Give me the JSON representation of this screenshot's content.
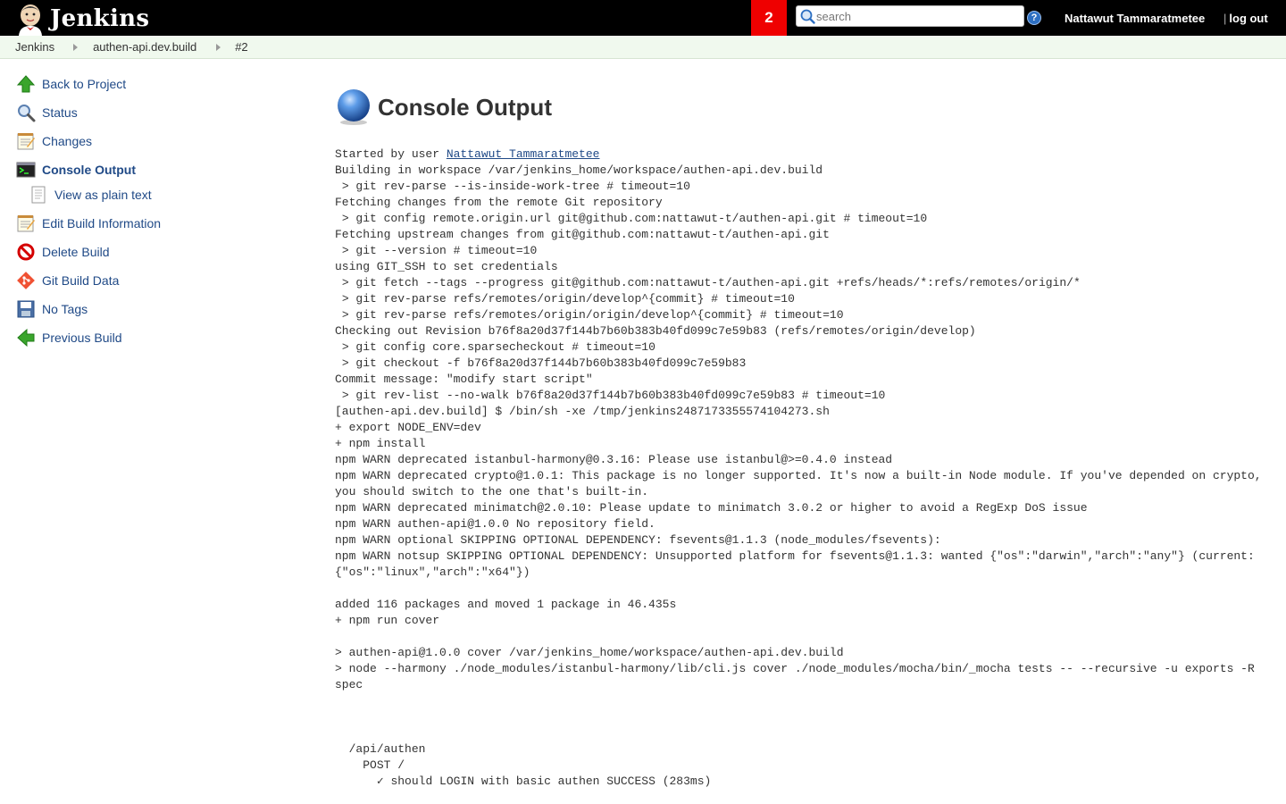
{
  "header": {
    "title": "Jenkins",
    "notification_count": "2",
    "search_placeholder": "search",
    "help_label": "?",
    "user_name": "Nattawut Tammaratmetee",
    "logout_label": "log out",
    "logout_separator": "|",
    "colors": {
      "bar": "#000000",
      "notification": "#ef0000"
    }
  },
  "breadcrumbs": [
    "Jenkins",
    "authen-api.dev.build",
    "#2"
  ],
  "sidebar": {
    "items": [
      {
        "label": "Back to Project",
        "icon": "up-arrow-icon"
      },
      {
        "label": "Status",
        "icon": "magnifier-icon"
      },
      {
        "label": "Changes",
        "icon": "notepad-icon"
      },
      {
        "label": "Console Output",
        "icon": "terminal-icon",
        "active": true
      },
      {
        "label": "View as plain text",
        "icon": "document-icon",
        "sub": true
      },
      {
        "label": "Edit Build Information",
        "icon": "notepad-icon"
      },
      {
        "label": "Delete Build",
        "icon": "no-entry-icon"
      },
      {
        "label": "Git Build Data",
        "icon": "git-icon"
      },
      {
        "label": "No Tags",
        "icon": "save-icon"
      },
      {
        "label": "Previous Build",
        "icon": "left-arrow-icon"
      }
    ]
  },
  "main": {
    "title": "Console Output",
    "started_by_prefix": "Started by user ",
    "started_by_user": "Nattawut Tammaratmetee",
    "console_text": "Building in workspace /var/jenkins_home/workspace/authen-api.dev.build\n > git rev-parse --is-inside-work-tree # timeout=10\nFetching changes from the remote Git repository\n > git config remote.origin.url git@github.com:nattawut-t/authen-api.git # timeout=10\nFetching upstream changes from git@github.com:nattawut-t/authen-api.git\n > git --version # timeout=10\nusing GIT_SSH to set credentials\n > git fetch --tags --progress git@github.com:nattawut-t/authen-api.git +refs/heads/*:refs/remotes/origin/*\n > git rev-parse refs/remotes/origin/develop^{commit} # timeout=10\n > git rev-parse refs/remotes/origin/origin/develop^{commit} # timeout=10\nChecking out Revision b76f8a20d37f144b7b60b383b40fd099c7e59b83 (refs/remotes/origin/develop)\n > git config core.sparsecheckout # timeout=10\n > git checkout -f b76f8a20d37f144b7b60b383b40fd099c7e59b83\nCommit message: \"modify start script\"\n > git rev-list --no-walk b76f8a20d37f144b7b60b383b40fd099c7e59b83 # timeout=10\n[authen-api.dev.build] $ /bin/sh -xe /tmp/jenkins2487173355574104273.sh\n+ export NODE_ENV=dev\n+ npm install\nnpm WARN deprecated istanbul-harmony@0.3.16: Please use istanbul@>=0.4.0 instead\nnpm WARN deprecated crypto@1.0.1: This package is no longer supported. It's now a built-in Node module. If you've depended on crypto, you should switch to the one that's built-in.\nnpm WARN deprecated minimatch@2.0.10: Please update to minimatch 3.0.2 or higher to avoid a RegExp DoS issue\nnpm WARN authen-api@1.0.0 No repository field.\nnpm WARN optional SKIPPING OPTIONAL DEPENDENCY: fsevents@1.1.3 (node_modules/fsevents):\nnpm WARN notsup SKIPPING OPTIONAL DEPENDENCY: Unsupported platform for fsevents@1.1.3: wanted {\"os\":\"darwin\",\"arch\":\"any\"} (current: {\"os\":\"linux\",\"arch\":\"x64\"})\n\nadded 116 packages and moved 1 package in 46.435s\n+ npm run cover\n\n> authen-api@1.0.0 cover /var/jenkins_home/workspace/authen-api.dev.build\n> node --harmony ./node_modules/istanbul-harmony/lib/cli.js cover ./node_modules/mocha/bin/_mocha tests -- --recursive -u exports -R spec\n\n\n\n  /api/authen\n    POST /\n      ✓ should LOGIN with basic authen SUCCESS (283ms)"
  }
}
